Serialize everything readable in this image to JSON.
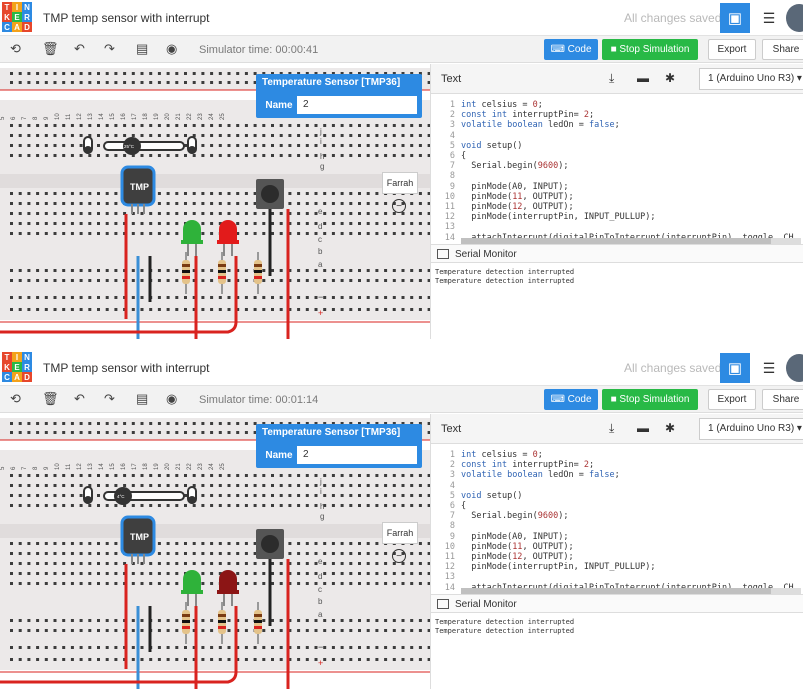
{
  "app": {
    "title": "TMP temp sensor with interrupt",
    "saved_status": "All changes saved",
    "logo_letters": [
      "T",
      "I",
      "N",
      "K",
      "E",
      "R",
      "C",
      "A",
      "D"
    ]
  },
  "toolbar": {
    "code_label": "Code",
    "stop_label": "Stop Simulation",
    "export_label": "Export",
    "share_label": "Share"
  },
  "panels": [
    {
      "sim_time": "Simulator time: 00:00:41",
      "temp_label": "25°C",
      "red_led_on": true
    },
    {
      "sim_time": "Simulator time: 00:01:14",
      "temp_label": "4°C",
      "red_led_on": false
    }
  ],
  "property_popup": {
    "title": "Temperature Sensor [TMP36]",
    "name_label": "Name",
    "name_value": "2"
  },
  "tooltip": {
    "text": "Farrah"
  },
  "sensor_label": "TMP",
  "code_panel": {
    "mode": "Text",
    "device": "1 (Arduino Uno R3)",
    "serial_label": "Serial Monitor",
    "lines": [
      {
        "n": "1",
        "t": "int celsius = 0;"
      },
      {
        "n": "2",
        "t": "const int interruptPin= 2;"
      },
      {
        "n": "3",
        "t": "volatile boolean ledOn = false;"
      },
      {
        "n": "4",
        "t": ""
      },
      {
        "n": "5",
        "t": "void setup()"
      },
      {
        "n": "6",
        "t": "{"
      },
      {
        "n": "7",
        "t": "  Serial.begin(9600);"
      },
      {
        "n": "8",
        "t": ""
      },
      {
        "n": "9",
        "t": "  pinMode(A0, INPUT);"
      },
      {
        "n": "10",
        "t": "  pinMode(11, OUTPUT);"
      },
      {
        "n": "11",
        "t": "  pinMode(12, OUTPUT);"
      },
      {
        "n": "12",
        "t": "  pinMode(interruptPin, INPUT_PULLUP);"
      },
      {
        "n": "13",
        "t": ""
      },
      {
        "n": "14",
        "t": "  attachInterrupt(digitalPinToInterrupt(interruptPin), toggle, CH"
      }
    ],
    "serial_output": [
      "Temperature detection interrupted",
      "Temperature detection interrupted"
    ]
  },
  "colors": {
    "accent": "#2d8ae2",
    "stop": "#28b946",
    "wire_red": "#d9231f",
    "wire_blue": "#3a8fd6",
    "led_green": "#2fb23a",
    "led_red_on": "#e21b1b",
    "led_red_off": "#8c1515"
  }
}
